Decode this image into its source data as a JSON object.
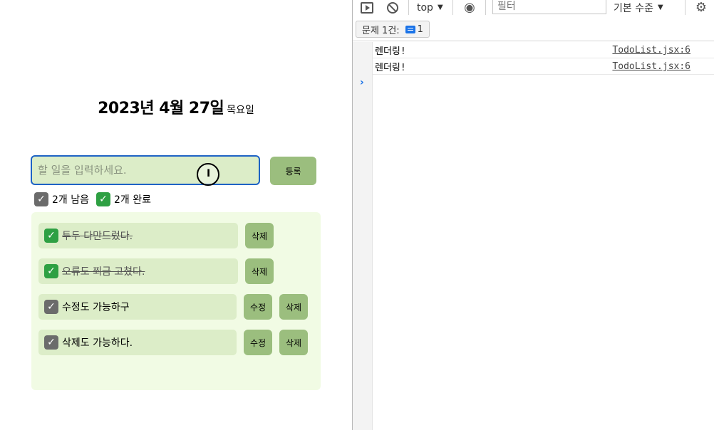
{
  "app": {
    "date": "2023년 4월 27일",
    "weekday": "목요일",
    "input_placeholder": "할 일을 입력하세요.",
    "register_label": "등록",
    "counts": {
      "remaining_label": "2개 남음",
      "completed_label": "2개 완료"
    },
    "todos": [
      {
        "text": "투두 다만드렀다.",
        "done": true,
        "buttons": [
          "삭제"
        ]
      },
      {
        "text": "오류도 쬐금 고쳤다.",
        "done": true,
        "buttons": [
          "삭제"
        ]
      },
      {
        "text": "수정도 가능하구",
        "done": false,
        "buttons": [
          "수정",
          "삭제"
        ]
      },
      {
        "text": "삭제도 가능하다.",
        "done": false,
        "buttons": [
          "수정",
          "삭제"
        ]
      }
    ]
  },
  "devtools": {
    "context": "top",
    "filter_placeholder": "필터",
    "level": "기본 수준",
    "issues_label": "문제 1건:",
    "issues_count": "1",
    "logs": [
      {
        "message": "렌더링!",
        "source": "TodoList.jsx:6"
      },
      {
        "message": "렌더링!",
        "source": "TodoList.jsx:6"
      }
    ]
  },
  "icons": {
    "checkbox_gray": "☑",
    "checkbox_green": "✅"
  },
  "colors": {
    "accent_green": "#9bbe7e",
    "input_bg": "#dcedc8",
    "panel_bg": "#f1fbe4",
    "focus_border": "#1e63c5"
  }
}
